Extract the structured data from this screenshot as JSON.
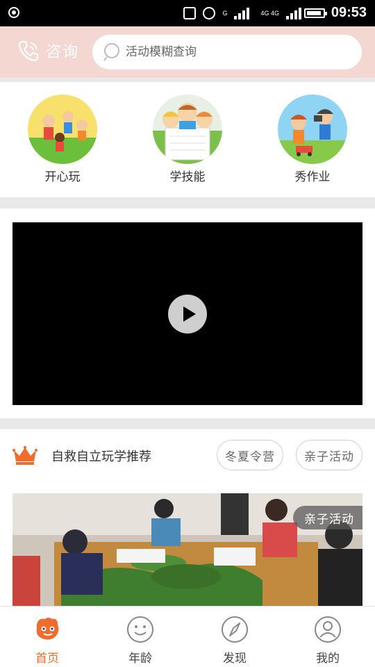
{
  "status_bar": {
    "time": "09:53",
    "network_1": "G",
    "network_2": "4G 4G"
  },
  "header": {
    "consult_label": "咨询",
    "search_placeholder": "活动模糊查询"
  },
  "categories": [
    {
      "label": "开心玩",
      "icon": "play-kids-icon"
    },
    {
      "label": "学技能",
      "icon": "learn-skills-icon"
    },
    {
      "label": "秀作业",
      "icon": "show-homework-icon"
    }
  ],
  "video": {
    "play_icon": "play-icon"
  },
  "recommendation": {
    "title": "自救自立玩学推荐",
    "tags": [
      "冬夏令营",
      "亲子活动"
    ]
  },
  "photo_card": {
    "badge": "亲子活动"
  },
  "bottom_nav": [
    {
      "label": "首页",
      "icon": "home-mascot-icon",
      "active": true
    },
    {
      "label": "年龄",
      "icon": "smiley-face-icon",
      "active": false
    },
    {
      "label": "发现",
      "icon": "compass-icon",
      "active": false
    },
    {
      "label": "我的",
      "icon": "user-profile-icon",
      "active": false
    }
  ],
  "colors": {
    "header_bg": "#f3d7d0",
    "accent": "#f06c2e",
    "crown": "#f06c2e"
  }
}
